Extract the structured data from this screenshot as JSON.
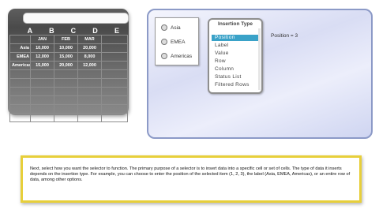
{
  "spreadsheet": {
    "columns": [
      "A",
      "B",
      "C",
      "D",
      "E"
    ],
    "header_row": [
      "",
      "JAN",
      "FEB",
      "MAR",
      ""
    ],
    "rows": [
      [
        "Asia",
        "10,000",
        "10,000",
        "20,000",
        ""
      ],
      [
        "EMEA",
        "12,000",
        "15,000",
        "8,000",
        ""
      ],
      [
        "Americas",
        "15,000",
        "20,000",
        "12,000",
        ""
      ]
    ],
    "empty_rows": 6
  },
  "selector": {
    "radio_options": [
      "Asia",
      "EMEA",
      "Americas"
    ],
    "insertion_type": {
      "title": "Insertion Type",
      "items": [
        "Position",
        "Label",
        "Value",
        "Row",
        "Column",
        "Status List",
        "Filtered Rows"
      ],
      "selected_index": 0
    },
    "position_text": "Position = 3"
  },
  "instructions": {
    "text": "Next, select how you want the selector to function. The primary purpose of a selector is to insert data into a specific cell or set of cells. The type of data it inserts depends on the insertion type. For example, you can choose to enter the position of the selected item (1, 2, 3), the label (Asia, EMEA, Americas), or an entire row of data, among other options."
  },
  "colors": {
    "selected_item": "#3aa2c8",
    "panel_border": "#8c9ac7",
    "instruction_border": "#e7cf3a",
    "sheet_background": "#5a5a5a"
  }
}
